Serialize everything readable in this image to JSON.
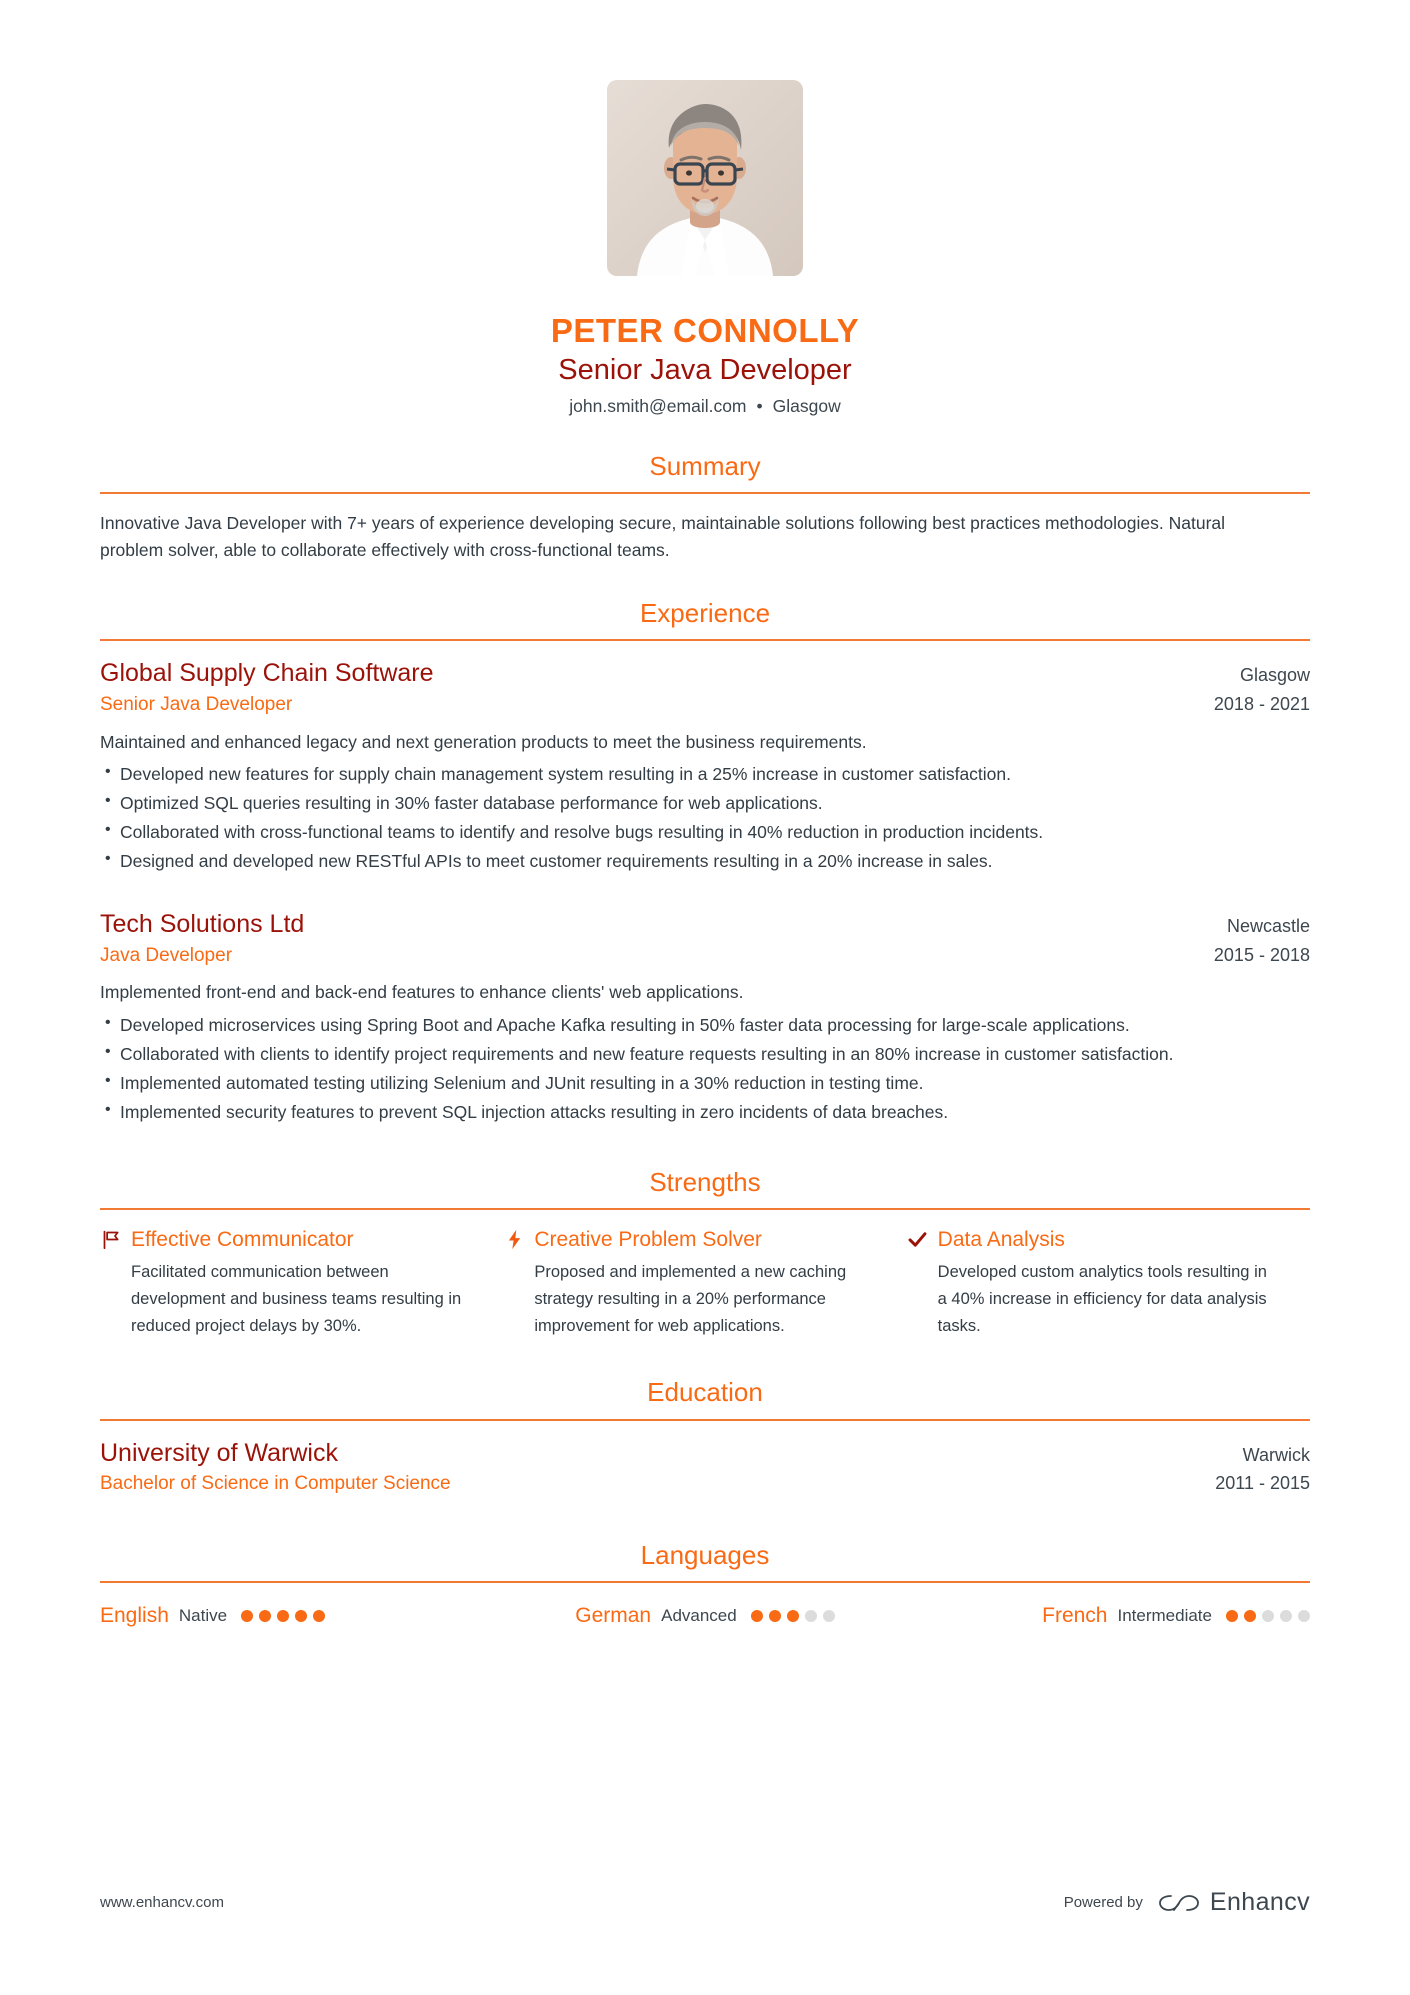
{
  "colors": {
    "accent": "#f96a14",
    "dark_red": "#9b1209",
    "text": "#333d45",
    "rule": "#f27a35",
    "dot_off": "#dcdcdc"
  },
  "header": {
    "photo_alt": "profile-photo",
    "name": "PETER CONNOLLY",
    "job_title": "Senior Java Developer",
    "email": "john.smith@email.com",
    "separator": "•",
    "location": "Glasgow"
  },
  "sections": {
    "summary": {
      "title": "Summary",
      "text": "Innovative Java Developer with 7+ years of experience developing secure, maintainable solutions following best practices methodologies. Natural problem solver, able to collaborate effectively with cross-functional teams."
    },
    "experience": {
      "title": "Experience",
      "entries": [
        {
          "organization": "Global Supply Chain Software",
          "location": "Glasgow",
          "role": "Senior Java Developer",
          "dates": "2018 - 2021",
          "description": "Maintained and enhanced legacy and next generation products to meet the business requirements.",
          "bullets": [
            "Developed new features for supply chain management system resulting in a 25% increase in customer satisfaction.",
            "Optimized SQL queries resulting in 30% faster database performance for web applications.",
            "Collaborated with cross-functional teams to identify and resolve bugs resulting in 40% reduction in production incidents.",
            "Designed and developed new RESTful APIs to meet customer requirements resulting in a 20% increase in sales."
          ]
        },
        {
          "organization": "Tech Solutions Ltd",
          "location": "Newcastle",
          "role": "Java Developer",
          "dates": "2015 - 2018",
          "description": "Implemented front-end and back-end features to enhance clients' web applications.",
          "bullets": [
            "Developed microservices using Spring Boot and Apache Kafka resulting in 50% faster data processing for large-scale applications.",
            "Collaborated with clients to identify project requirements and new feature requests resulting in an 80% increase in customer satisfaction.",
            "Implemented automated testing utilizing Selenium and JUnit resulting in a 30% reduction in testing time.",
            "Implemented security features to prevent SQL injection attacks resulting in zero incidents of data breaches."
          ]
        }
      ]
    },
    "strengths": {
      "title": "Strengths",
      "items": [
        {
          "icon": "flag-icon",
          "title": "Effective Communicator",
          "description": "Facilitated communication between development and business teams resulting in reduced project delays by 30%."
        },
        {
          "icon": "lightning-bolt-icon",
          "title": "Creative Problem Solver",
          "description": "Proposed and implemented a new caching strategy resulting in a 20% performance improvement for web applications."
        },
        {
          "icon": "checkmark-icon",
          "title": "Data Analysis",
          "description": "Developed custom analytics tools resulting in a 40% increase in efficiency for data analysis tasks."
        }
      ]
    },
    "education": {
      "title": "Education",
      "entries": [
        {
          "institution": "University of Warwick",
          "location": "Warwick",
          "degree": "Bachelor of Science in Computer Science",
          "dates": "2011 - 2015"
        }
      ]
    },
    "languages": {
      "title": "Languages",
      "items": [
        {
          "name": "English",
          "level": "Native",
          "filled": 5,
          "total": 5
        },
        {
          "name": "German",
          "level": "Advanced",
          "filled": 3,
          "total": 5
        },
        {
          "name": "French",
          "level": "Intermediate",
          "filled": 2,
          "total": 5
        }
      ]
    }
  },
  "footer": {
    "url": "www.enhancv.com",
    "powered_by": "Powered by",
    "brand": "Enhancv"
  }
}
